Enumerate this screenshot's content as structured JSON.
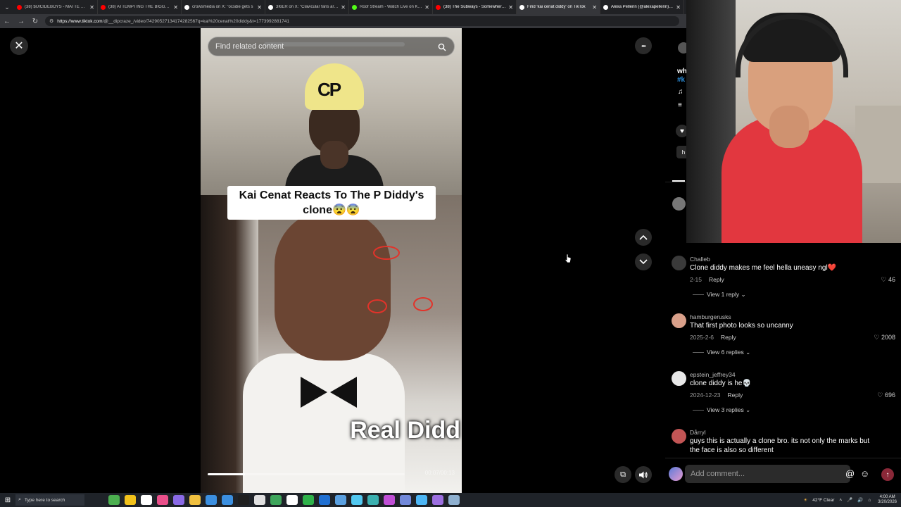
{
  "browser": {
    "tabs": [
      {
        "title": "(38) $UICIDEBOYS - MATTE BLACK",
        "favicon_color": "#ff0000",
        "active": false
      },
      {
        "title": "(38) ATTEMPTING THE BIGGEST B",
        "favicon_color": "#ff0000",
        "active": false
      },
      {
        "title": "crowsmedia on X: \"ocsdie gets s",
        "favicon_color": "#ffffff",
        "active": false
      },
      {
        "title": "3I6ER on X: \"Clavicular fans are S",
        "favicon_color": "#ffffff",
        "active": false
      },
      {
        "title": "Roof Stream - Watch Live on Kick",
        "favicon_color": "#53fc18",
        "active": false
      },
      {
        "title": "(38) The Subways - Somewhere (C",
        "favicon_color": "#ff0000",
        "active": false
      },
      {
        "title": "Find 'kai cenat diddy' on TikTok",
        "favicon_color": "#ffffff",
        "active": true
      },
      {
        "title": "Alexa Pellerin (@alexapellerin) | Ti",
        "favicon_color": "#ffffff",
        "active": false
      }
    ],
    "url_domain": "https://www.tiktok.com",
    "url_path": "/@__dipcraze_/video/74290527134174282567q=kai%20cenat%20diddy&t=1773992881741",
    "tab_close_glyph": "✕"
  },
  "video": {
    "search_placeholder": "Find related content",
    "caption_line1": "Kai Cenat Reacts To The P Diddy's",
    "caption_line2": "clone😨😨",
    "overlay_text": "Real Didd",
    "hat_text": "CP",
    "progress_fraction": 0.19,
    "time_display": "00:07/00:13"
  },
  "controls": {
    "close_glyph": "✕",
    "more_glyph": "•••",
    "up_glyph": "︿",
    "down_glyph": "﹀",
    "volume_glyph": "🔊",
    "miniplayer_glyph": "⧉"
  },
  "panel": {
    "desc_fragment": "wh",
    "hashtag_fragment": "#k",
    "music_glyph": "♫",
    "list_glyph": "≡",
    "heart_glyph": "♥",
    "chip_text": "h",
    "comments": [
      {
        "username": "Challeb",
        "text": "Clone diddy makes me feel hella uneasy ngl❤️",
        "date": "2-15",
        "reply_label": "Reply",
        "likes": "46",
        "view_replies": "View 1 reply",
        "avatar_color": "#3a3a3a"
      },
      {
        "username": "hamburgerusks",
        "text": "That first photo looks so uncanny",
        "date": "2025-2-6",
        "reply_label": "Reply",
        "likes": "2008",
        "view_replies": "View 6 replies",
        "avatar_color": "#d9a08a"
      },
      {
        "username": "epstein_jeffrey34",
        "text": "clone diddy is he💀",
        "date": "2024-12-23",
        "reply_label": "Reply",
        "likes": "696",
        "view_replies": "View 3 replies",
        "avatar_color": "#e8e8e8"
      },
      {
        "username": "Dårryl",
        "text": "guys this is actually a clone bro. its not only the marks but the face is also so different",
        "date": "",
        "reply_label": "",
        "likes": "",
        "view_replies": "",
        "avatar_color": "#c25555"
      }
    ],
    "add_comment_placeholder": "Add comment...",
    "at_glyph": "@",
    "emoji_glyph": "☺",
    "send_glyph": "↑",
    "heart_small": "♡",
    "chevron_small": "⌄"
  },
  "taskbar": {
    "start_glyph": "⊞",
    "search_placeholder": "Type here to search",
    "weather": "42°F Clear",
    "time": "4:00 AM",
    "date": "3/20/2026",
    "app_colors": [
      "#4caf50",
      "#f2c21b",
      "#ffffff",
      "#e94f8a",
      "#8a6ae6",
      "#f0c040",
      "#3b8fe0",
      "#3b8fe0",
      "#1f1f1f",
      "#e0e0e0",
      "#3ea55b",
      "#ffffff",
      "#2fb24a",
      "#1f6fd1",
      "#5aa0e0",
      "#52c8f0",
      "#3bb0b0",
      "#c04fd6",
      "#7289da",
      "#4db6f5",
      "#9c6fe0",
      "#8fb0d0"
    ]
  }
}
